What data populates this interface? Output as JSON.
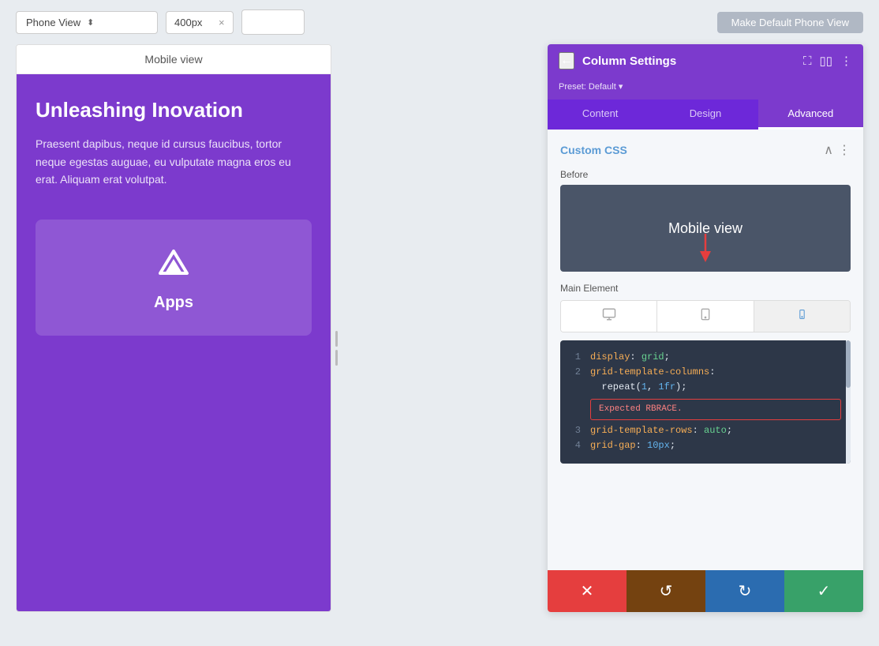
{
  "toolbar": {
    "view_label": "Phone View",
    "width_value": "400px",
    "close_label": "×",
    "make_default_label": "Make Default Phone View"
  },
  "mobile_preview": {
    "header_label": "Mobile view",
    "title": "Unleashing Inovation",
    "body_text": "Praesent dapibus, neque id cursus faucibus, tortor neque egestas auguae, eu vulputate magna eros eu erat. Aliquam erat volutpat.",
    "app_label": "Apps"
  },
  "settings": {
    "back_icon": "←",
    "title": "Column Settings",
    "preset_label": "Preset: Default ▾",
    "tabs": [
      {
        "id": "content",
        "label": "Content",
        "active": false
      },
      {
        "id": "design",
        "label": "Design",
        "active": false
      },
      {
        "id": "advanced",
        "label": "Advanced",
        "active": true
      }
    ],
    "custom_css": {
      "section_title": "Custom CSS",
      "before_label": "Before",
      "mobile_view_text": "Mobile view",
      "main_element_label": "Main Element",
      "devices": [
        {
          "icon": "🖥",
          "label": "desktop",
          "active": false
        },
        {
          "icon": "⬜",
          "label": "tablet",
          "active": false
        },
        {
          "icon": "📱",
          "label": "mobile",
          "active": true
        }
      ],
      "code_lines": [
        {
          "num": "1",
          "code": "display: grid;",
          "parts": [
            {
              "text": "display",
              "type": "prop"
            },
            {
              "text": ": ",
              "type": "plain"
            },
            {
              "text": "grid",
              "type": "val"
            },
            {
              "text": ";",
              "type": "plain"
            }
          ]
        },
        {
          "num": "2",
          "code": "grid-template-columns:",
          "parts": [
            {
              "text": "grid-template-columns:",
              "type": "prop"
            }
          ]
        },
        {
          "num": "2b",
          "code": "repeat(1, 1fr);",
          "parts": [
            {
              "text": "repeat(",
              "type": "plain"
            },
            {
              "text": "1",
              "type": "num"
            },
            {
              "text": ", ",
              "type": "plain"
            },
            {
              "text": "1fr",
              "type": "num"
            },
            {
              "text": ");",
              "type": "plain"
            }
          ]
        },
        {
          "num": "error",
          "code": "Expected RBRACE."
        },
        {
          "num": "3",
          "code": "grid-template-rows: auto;",
          "parts": [
            {
              "text": "grid-template-rows",
              "type": "prop"
            },
            {
              "text": ": ",
              "type": "plain"
            },
            {
              "text": "auto",
              "type": "val"
            },
            {
              "text": ";",
              "type": "plain"
            }
          ]
        },
        {
          "num": "4",
          "code": "grid-gap: 10px;",
          "parts": [
            {
              "text": "grid-gap",
              "type": "prop"
            },
            {
              "text": ": ",
              "type": "plain"
            },
            {
              "text": "10px",
              "type": "num"
            },
            {
              "text": ";",
              "type": "plain"
            }
          ]
        }
      ]
    }
  },
  "action_buttons": {
    "cancel_icon": "✕",
    "reset_icon": "↺",
    "redo_icon": "↻",
    "confirm_icon": "✓"
  },
  "colors": {
    "purple": "#7c3acd",
    "dark_purple": "#6d28d9",
    "mobile_bg": "#7c3acd",
    "editor_bg": "#2d3748",
    "cancel_red": "#e53e3e",
    "reset_brown": "#b7791f",
    "redo_blue": "#2b6cb0",
    "confirm_green": "#38a169"
  }
}
